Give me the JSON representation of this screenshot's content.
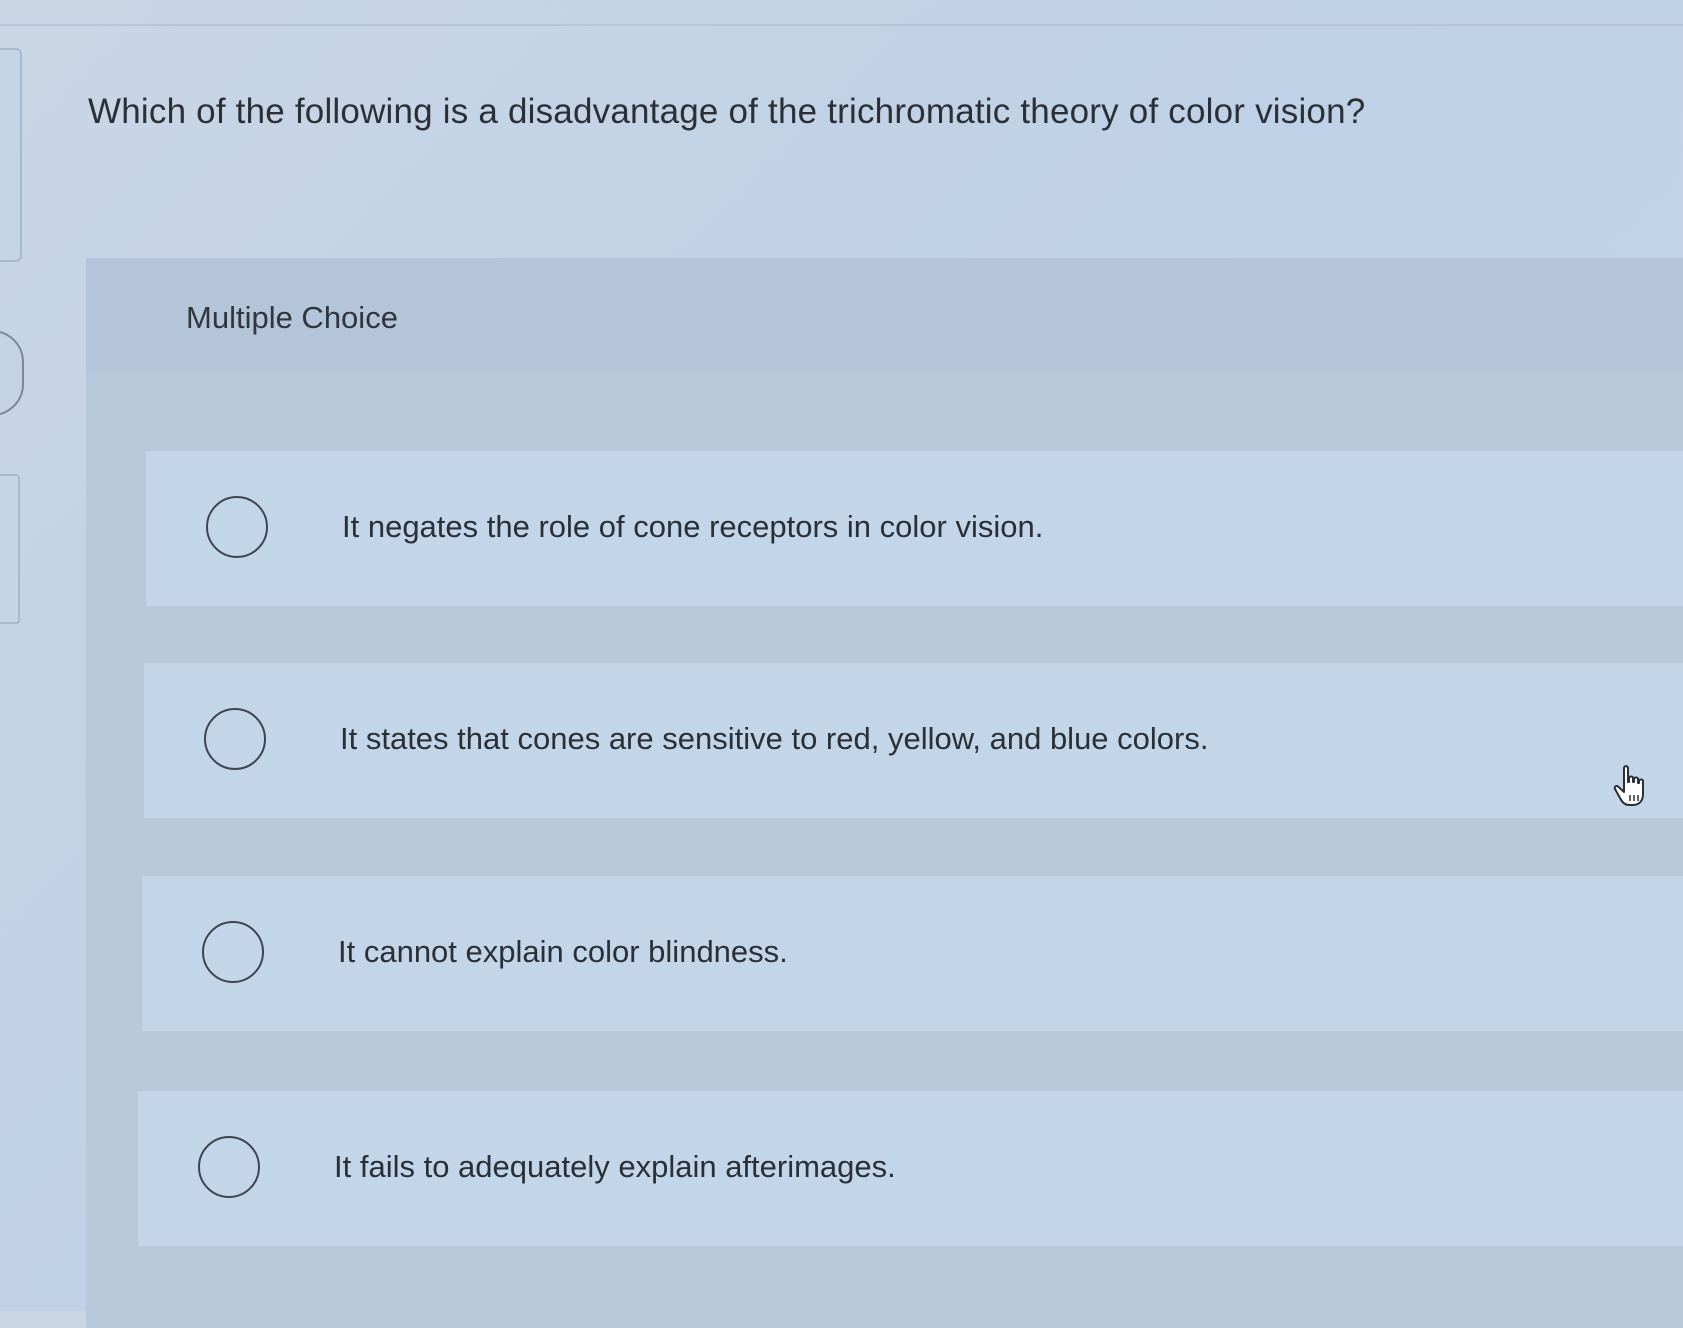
{
  "question": {
    "text": "Which of the following is a disadvantage of the trichromatic theory of color vision?"
  },
  "multiple_choice": {
    "label": "Multiple Choice",
    "options": [
      {
        "text": "It negates the role of cone receptors in color vision.",
        "selected": false
      },
      {
        "text": "It states that cones are sensitive to red, yellow, and blue colors.",
        "selected": false
      },
      {
        "text": "It cannot explain color blindness.",
        "selected": false
      },
      {
        "text": "It fails to adequately explain afterimages.",
        "selected": false
      }
    ]
  },
  "cursor": {
    "icon": "hand-pointer-icon"
  },
  "colors": {
    "background": "#c4d6ea",
    "option_background": "#c3d5e9",
    "radio_border": "#3e4450",
    "text": "#2b2f36"
  }
}
